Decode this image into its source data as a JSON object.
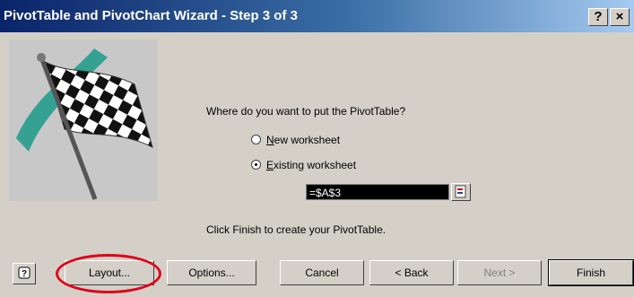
{
  "window": {
    "title": "PivotTable and PivotChart Wizard - Step 3 of 3",
    "help_label": "?",
    "close_label": "×"
  },
  "body": {
    "prompt": "Where do you want to put the PivotTable?",
    "options": [
      {
        "label": "New worksheet",
        "accel": "N",
        "rest": "ew worksheet",
        "selected": false
      },
      {
        "label": "Existing worksheet",
        "accel": "E",
        "rest": "xisting worksheet",
        "selected": true
      }
    ],
    "reference_value": "=$A$3",
    "finish_message": "Click Finish to create your PivotTable."
  },
  "buttons": {
    "layout": "Layout...",
    "options": "Options...",
    "cancel": "Cancel",
    "back": "< Back",
    "next": "Next >",
    "finish": "Finish"
  },
  "colors": {
    "title_bar_start": "#0a246a",
    "title_bar_end": "#a6caf0",
    "dialog_face": "#d4d0c8",
    "highlight_circle": "#e0001b"
  }
}
